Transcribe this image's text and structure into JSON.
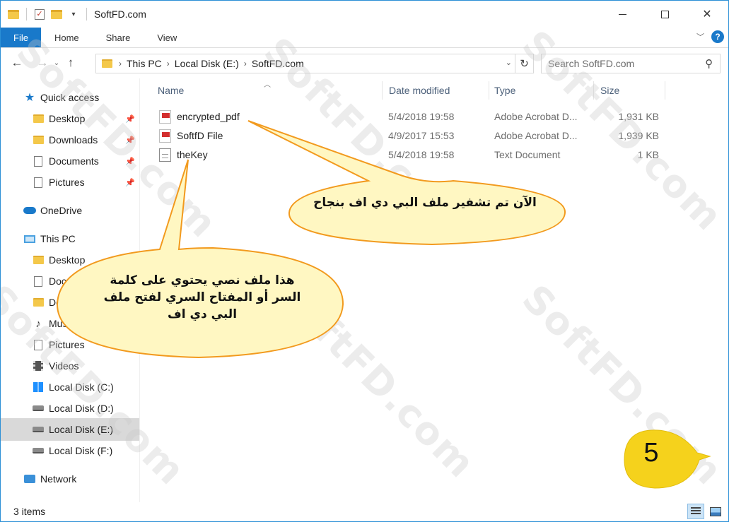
{
  "window": {
    "title": "SoftFD.com"
  },
  "ribbon": {
    "tabs": [
      "File",
      "Home",
      "Share",
      "View"
    ],
    "help_label": "?"
  },
  "address_bar": {
    "crumbs": [
      "This PC",
      "Local Disk (E:)",
      "SoftFD.com"
    ]
  },
  "search": {
    "placeholder": "Search SoftFD.com"
  },
  "sidebar": {
    "quick_access": "Quick access",
    "quick_items": [
      "Desktop",
      "Downloads",
      "Documents",
      "Pictures"
    ],
    "onedrive": "OneDrive",
    "this_pc": "This PC",
    "pc_items": [
      "Desktop",
      "Documents",
      "Downloads",
      "Music",
      "Pictures",
      "Videos"
    ],
    "drives": [
      "Local Disk (C:)",
      "Local Disk (D:)",
      "Local Disk (E:)",
      "Local Disk (F:)"
    ],
    "network": "Network"
  },
  "columns": {
    "name": "Name",
    "date": "Date modified",
    "type": "Type",
    "size": "Size"
  },
  "files": [
    {
      "name": "encrypted_pdf",
      "date": "5/4/2018 19:58",
      "type": "Adobe Acrobat D...",
      "size": "1,931 KB"
    },
    {
      "name": "SoftfD File",
      "date": "4/9/2017 15:53",
      "type": "Adobe Acrobat D...",
      "size": "1,939 KB"
    },
    {
      "name": "theKey",
      "date": "5/4/2018 19:58",
      "type": "Text Document",
      "size": "1 KB"
    }
  ],
  "status": {
    "item_count": "3 items"
  },
  "callouts": {
    "top": "الآن تم تشفير ملف البي دي اف بنجاح",
    "bottom": "هذا ملف نصي يحتوي على كلمة السر أو المفتاح السري لفتح ملف البي دي اف"
  },
  "step_badge": "5",
  "watermark": "SoftFD.com",
  "colors": {
    "accent": "#1979ca",
    "callout_fill": "#fff7c2",
    "callout_stroke": "#f29a1e",
    "step_fill": "#f5d21c"
  }
}
